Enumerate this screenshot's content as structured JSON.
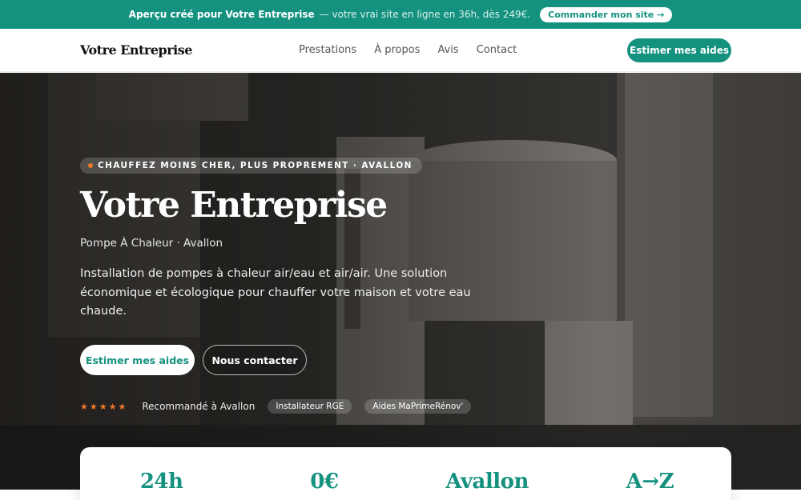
{
  "promo": {
    "strong_text": "Aperçu créé pour Votre Entreprise",
    "rest_text": "— votre vrai site en ligne en 36h, dès 249€.",
    "button_label": "Commander mon site →"
  },
  "header": {
    "logo": "Votre Entreprise",
    "nav": [
      "Prestations",
      "À propos",
      "Avis",
      "Contact"
    ],
    "cta_label": "Estimer mes aides"
  },
  "hero": {
    "eyebrow": "CHAUFFEZ MOINS CHER, PLUS PROPREMENT · AVALLON",
    "title": "Votre Entreprise",
    "subtitle": "Pompe À Chaleur · Avallon",
    "description": "Installation de pompes à chaleur air/eau et air/air. Une solution économique et écologique pour chauffer votre maison et votre eau chaude.",
    "primary_button": "Estimer mes aides",
    "secondary_button": "Nous contacter",
    "stars": "★★★★★",
    "recommendation": "Recommandé à Avallon",
    "badges": [
      "Installateur RGE",
      "Aides MaPrimeRénov'"
    ]
  },
  "stats": [
    "24h",
    "0€",
    "Avallon",
    "A→Z"
  ],
  "colors": {
    "accent": "#14917f",
    "star": "#f07a2a"
  }
}
